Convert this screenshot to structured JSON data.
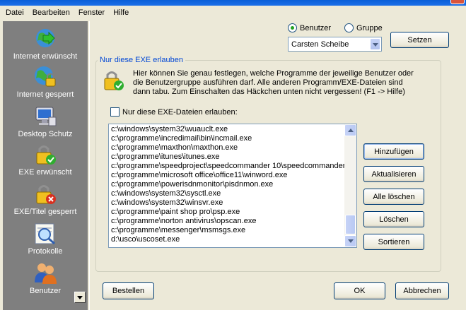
{
  "menu": {
    "items": [
      "Datei",
      "Bearbeiten",
      "Fenster",
      "Hilfe"
    ]
  },
  "sidebar": {
    "items": [
      {
        "label": "Internet erwünscht",
        "icon": "globe-arrow-icon"
      },
      {
        "label": "Internet gesperrt",
        "icon": "globe-lock-icon"
      },
      {
        "label": "Desktop Schutz",
        "icon": "monitor-icon"
      },
      {
        "label": "EXE erwünscht",
        "icon": "lock-check-icon"
      },
      {
        "label": "EXE/Titel gesperrt",
        "icon": "lock-cross-icon"
      },
      {
        "label": "Protokolle",
        "icon": "magnifier-icon"
      },
      {
        "label": "Benutzer",
        "icon": "users-icon"
      }
    ]
  },
  "target": {
    "radio_user_label": "Benutzer",
    "radio_group_label": "Gruppe",
    "selected": "Benutzer",
    "user_select_value": "Carsten Scheibe",
    "set_button": "Setzen"
  },
  "group": {
    "title": "Nur diese EXE erlauben",
    "description_lines": [
      "Hier können Sie genau festlegen, welche Programme der jeweilige Benutzer oder",
      "die Benutzergruppe ausführen darf. Alle anderen Programm/EXE-Dateien sind",
      "dann tabu. Zum Einschalten das Häckchen unten nicht vergessen! (F1 -> Hilfe)"
    ],
    "checkbox_label": "Nur diese EXE-Dateien erlauben:",
    "checkbox_checked": false
  },
  "exe_list": [
    "c:\\windows\\system32\\wuauclt.exe",
    "c:\\programme\\incredimail\\bin\\incmail.exe",
    "c:\\programme\\maxthon\\maxthon.exe",
    "c:\\programme\\itunes\\itunes.exe",
    "c:\\programme\\speedproject\\speedcommander 10\\speedcommander.exe",
    "c:\\programme\\microsoft office\\office11\\winword.exe",
    "c:\\programme\\powerisdnmonitor\\pisdnmon.exe",
    "c:\\windows\\system32\\sysctl.exe",
    "c:\\windows\\system32\\winsvr.exe",
    "c:\\programme\\paint shop pro\\psp.exe",
    "c:\\programme\\norton antivirus\\opscan.exe",
    "c:\\programme\\messenger\\msmsgs.exe",
    "d:\\usco\\uscoset.exe"
  ],
  "actions": {
    "add": "Hinzufügen",
    "refresh": "Aktualisieren",
    "delete_all": "Alle löschen",
    "delete": "Löschen",
    "sort": "Sortieren"
  },
  "footer": {
    "order": "Bestellen",
    "ok": "OK",
    "cancel": "Abbrechen"
  }
}
